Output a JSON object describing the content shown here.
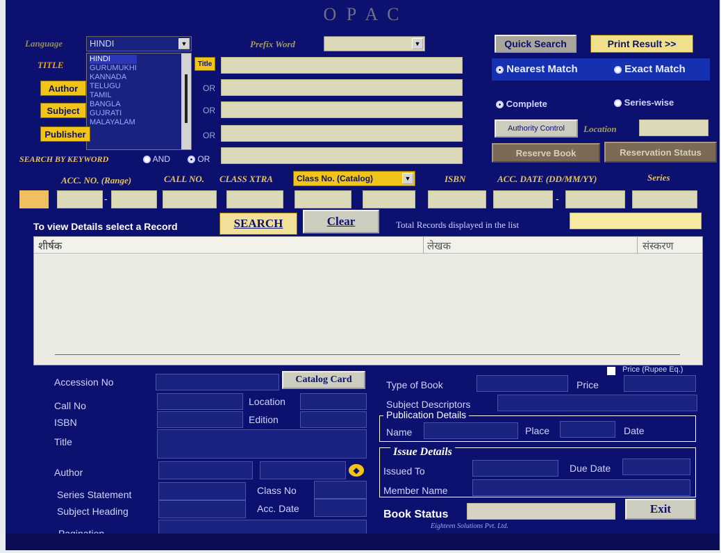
{
  "app": {
    "title": "O P A C"
  },
  "top": {
    "language_label": "Language",
    "language_value": "HINDI",
    "language_options": [
      "HINDI",
      "GURUMUKHI",
      "KANNADA",
      "TELUGU",
      "TAMIL",
      "BANGLA",
      "GUJRATI",
      "MALAYALAM"
    ],
    "prefix_word_label": "Prefix Word",
    "prefix_word_value": "",
    "quick_search": "Quick Search",
    "print_result": "Print Result >>",
    "nearest_match": "Nearest Match",
    "exact_match": "Exact Match",
    "complete": "Complete",
    "series_wise": "Series-wise",
    "authority_control": "Authority Control",
    "location_label": "Location",
    "reserve_book": "Reserve Book",
    "reservation_status": "Reservation Status"
  },
  "search_rows": {
    "title_label": "TITLE",
    "title_tag": "Title",
    "author": "Author",
    "subject": "Subject",
    "publisher": "Publisher",
    "or": "OR",
    "search_by_keyword": "SEARCH BY KEYWORD",
    "and": "AND"
  },
  "acc_row": {
    "acc_no_range": "ACC. NO. (Range)",
    "call_no": "CALL NO.",
    "class_xtra": "CLASS XTRA",
    "class_no_catalog": "Class No. (Catalog)",
    "isbn": "ISBN",
    "acc_date": "ACC. DATE (DD/MM/YY)",
    "series": "Series",
    "dash": "-"
  },
  "actions": {
    "view_details_hint": "To view Details select a Record",
    "search": "SEARCH",
    "clear": "Clear",
    "total_records_label": "Total Records displayed in the list",
    "total_records_value": ""
  },
  "results": {
    "columns": [
      "शीर्षक",
      "लेखक",
      "संस्करण"
    ],
    "rows": []
  },
  "details": {
    "accession_no": "Accession No",
    "catalog_card": "Catalog Card",
    "call_no": "Call No",
    "location": "Location",
    "isbn": "ISBN",
    "edition": "Edition",
    "title": "Title",
    "author": "Author",
    "series_statement": "Series Statement",
    "class_no": "Class No",
    "subject_heading": "Subject Heading",
    "acc_date": "Acc. Date",
    "pagination": "Pagination",
    "price_rupee_eq": "Price (Rupee Eq.)",
    "type_of_book": "Type of Book",
    "price": "Price",
    "subject_descriptors": "Subject Descriptors",
    "publication_details": "Publication Details",
    "name": "Name",
    "place": "Place",
    "date": "Date",
    "issue_details": "Issue Details",
    "issued_to": "Issued To",
    "due_date": "Due Date",
    "member_name": "Member Name",
    "book_status": "Book Status",
    "exit": "Exit",
    "footer_credit": "Eighteen Solutions Pvt. Ltd."
  },
  "colors": {
    "window_bg": "#0c1170",
    "field_bg": "#dcd9b8",
    "accent_yellow": "#f0c419",
    "accent_gold": "#e5c25a"
  }
}
